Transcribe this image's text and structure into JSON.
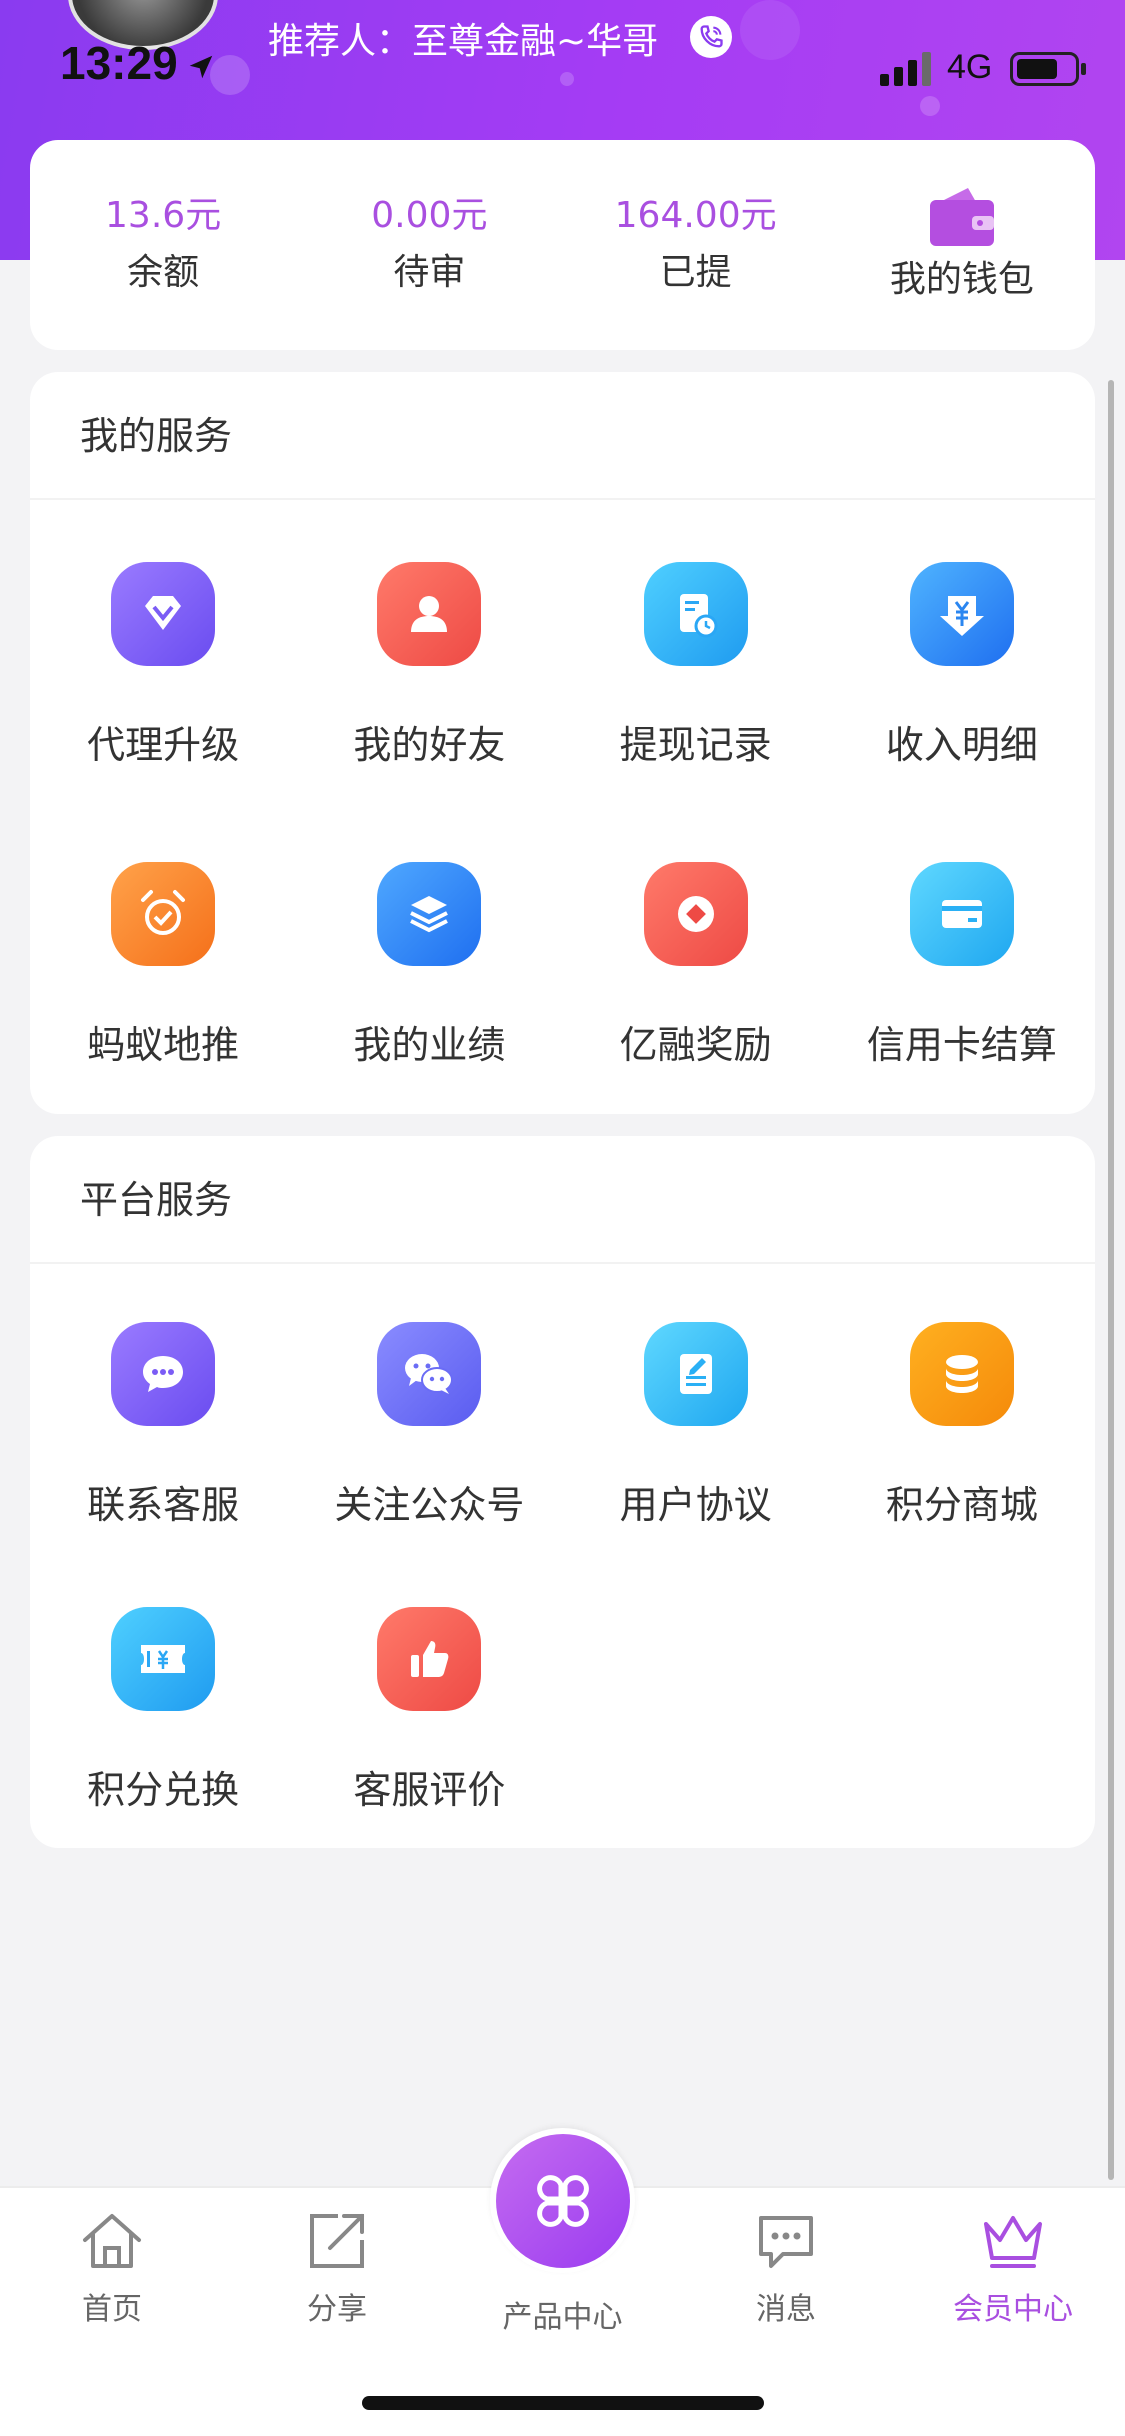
{
  "status_bar": {
    "time": "13:29",
    "network": "4G"
  },
  "header": {
    "referrer_text": "推荐人：至尊金融~华哥"
  },
  "wallet": {
    "balance_amount": "13.6元",
    "balance_label": "余额",
    "pending_amount": "0.00元",
    "pending_label": "待审",
    "withdrawn_amount": "164.00元",
    "withdrawn_label": "已提",
    "wallet_label": "我的钱包"
  },
  "my_services": {
    "title": "我的服务",
    "items": [
      {
        "label": "代理升级",
        "icon": "diamond-icon",
        "color": "#7b5cf5"
      },
      {
        "label": "我的好友",
        "icon": "user-icon",
        "color": "#f2544c"
      },
      {
        "label": "提现记录",
        "icon": "receipt-clock-icon",
        "color": "#2aa7f5"
      },
      {
        "label": "收入明细",
        "icon": "yen-download-icon",
        "color": "#2a86f0"
      },
      {
        "label": "蚂蚁地推",
        "icon": "alarm-check-icon",
        "color": "#f7842a"
      },
      {
        "label": "我的业绩",
        "icon": "layers-icon",
        "color": "#2f86f0"
      },
      {
        "label": "亿融奖励",
        "icon": "coin-icon",
        "color": "#f2544c"
      },
      {
        "label": "信用卡结算",
        "icon": "credit-card-icon",
        "color": "#2ab0f5"
      }
    ]
  },
  "platform_services": {
    "title": "平台服务",
    "items": [
      {
        "label": "联系客服",
        "icon": "chat-bubble-icon",
        "color": "#7b5cf5"
      },
      {
        "label": "关注公众号",
        "icon": "wechat-icon",
        "color": "#6a6cf5"
      },
      {
        "label": "用户协议",
        "icon": "document-edit-icon",
        "color": "#2ab0f5"
      },
      {
        "label": "积分商城",
        "icon": "coin-stack-icon",
        "color": "#f7a20a"
      },
      {
        "label": "积分兑换",
        "icon": "ticket-yen-icon",
        "color": "#2aa7f5"
      },
      {
        "label": "客服评价",
        "icon": "thumbs-up-icon",
        "color": "#f2544c"
      }
    ]
  },
  "tabbar": {
    "home": "首页",
    "share": "分享",
    "products": "产品中心",
    "messages": "消息",
    "member": "会员中心",
    "active_color": "#a94fe0"
  }
}
